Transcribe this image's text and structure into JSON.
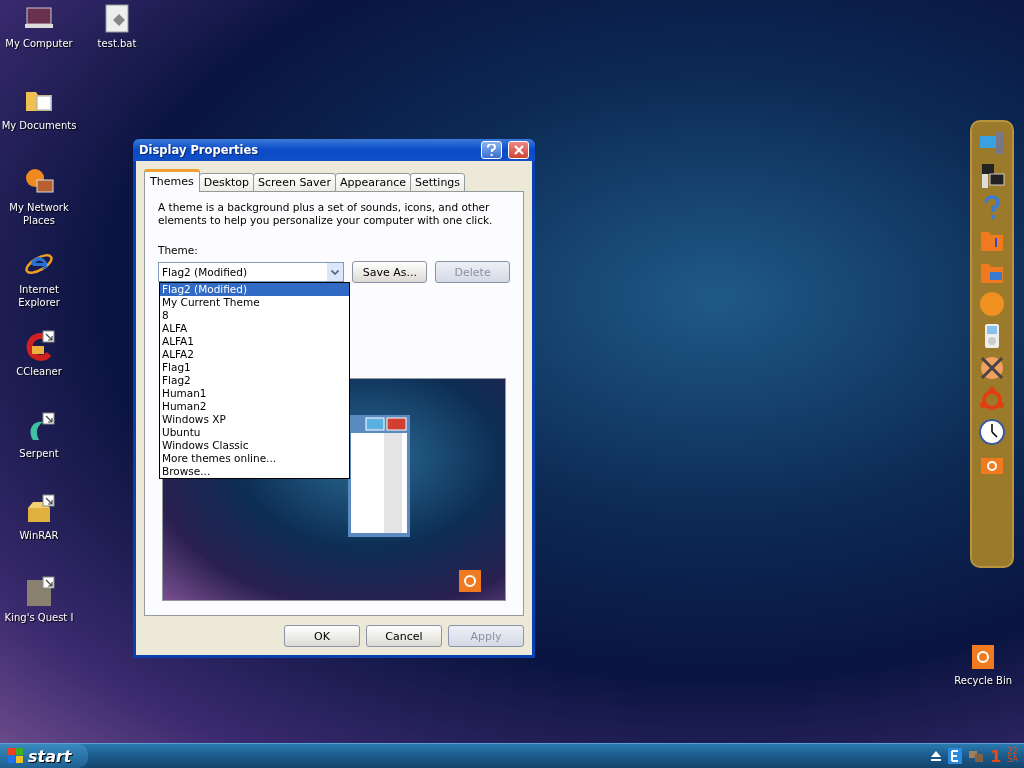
{
  "desktop_icons": [
    {
      "label": "My Computer",
      "kind": "computer",
      "shortcut": false
    },
    {
      "label": "My Documents",
      "kind": "documents",
      "shortcut": false
    },
    {
      "label": "My Network Places",
      "kind": "network",
      "shortcut": false
    },
    {
      "label": "Internet Explorer",
      "kind": "browser",
      "shortcut": false
    },
    {
      "label": "CCleaner",
      "kind": "cleaner",
      "shortcut": true
    },
    {
      "label": "Serpent",
      "kind": "serpent",
      "shortcut": true
    },
    {
      "label": "WinRAR",
      "kind": "archive",
      "shortcut": true
    },
    {
      "label": "King's Quest I",
      "kind": "game",
      "shortcut": true
    },
    {
      "label": "test.bat",
      "kind": "file",
      "shortcut": false
    }
  ],
  "recycle_bin": {
    "label": "Recycle Bin"
  },
  "dialog": {
    "title": "Display Properties",
    "tabs": [
      {
        "label": "Themes",
        "selected": true
      },
      {
        "label": "Desktop",
        "selected": false
      },
      {
        "label": "Screen Saver",
        "selected": false
      },
      {
        "label": "Appearance",
        "selected": false
      },
      {
        "label": "Settings",
        "selected": false
      }
    ],
    "description": "A theme is a background plus a set of sounds, icons, and other elements to help you personalize your computer with one click.",
    "theme_label": "Theme:",
    "theme_value": "Flag2 (Modified)",
    "theme_buttons": [
      {
        "label": "Save As...",
        "disabled": false
      },
      {
        "label": "Delete",
        "disabled": true
      }
    ],
    "theme_options": [
      {
        "label": "Flag2 (Modified)",
        "selected": true
      },
      {
        "label": "My Current Theme",
        "selected": false
      },
      {
        "label": "8",
        "selected": false
      },
      {
        "label": "ALFA",
        "selected": false
      },
      {
        "label": "ALFA1",
        "selected": false
      },
      {
        "label": "ALFA2",
        "selected": false
      },
      {
        "label": "Flag1",
        "selected": false
      },
      {
        "label": "Flag2",
        "selected": false
      },
      {
        "label": "Human1",
        "selected": false
      },
      {
        "label": "Human2",
        "selected": false
      },
      {
        "label": "Windows XP",
        "selected": false
      },
      {
        "label": "Ubuntu",
        "selected": false
      },
      {
        "label": "Windows Classic",
        "selected": false
      },
      {
        "label": "More themes online...",
        "selected": false
      },
      {
        "label": "Browse...",
        "selected": false
      }
    ],
    "buttons": [
      {
        "label": "OK",
        "disabled": false
      },
      {
        "label": "Cancel",
        "disabled": false
      },
      {
        "label": "Apply",
        "disabled": true
      }
    ]
  },
  "taskbar": {
    "start_label": "start",
    "clock": {
      "hour": "1",
      "minutes": "22",
      "period": "SA"
    }
  }
}
